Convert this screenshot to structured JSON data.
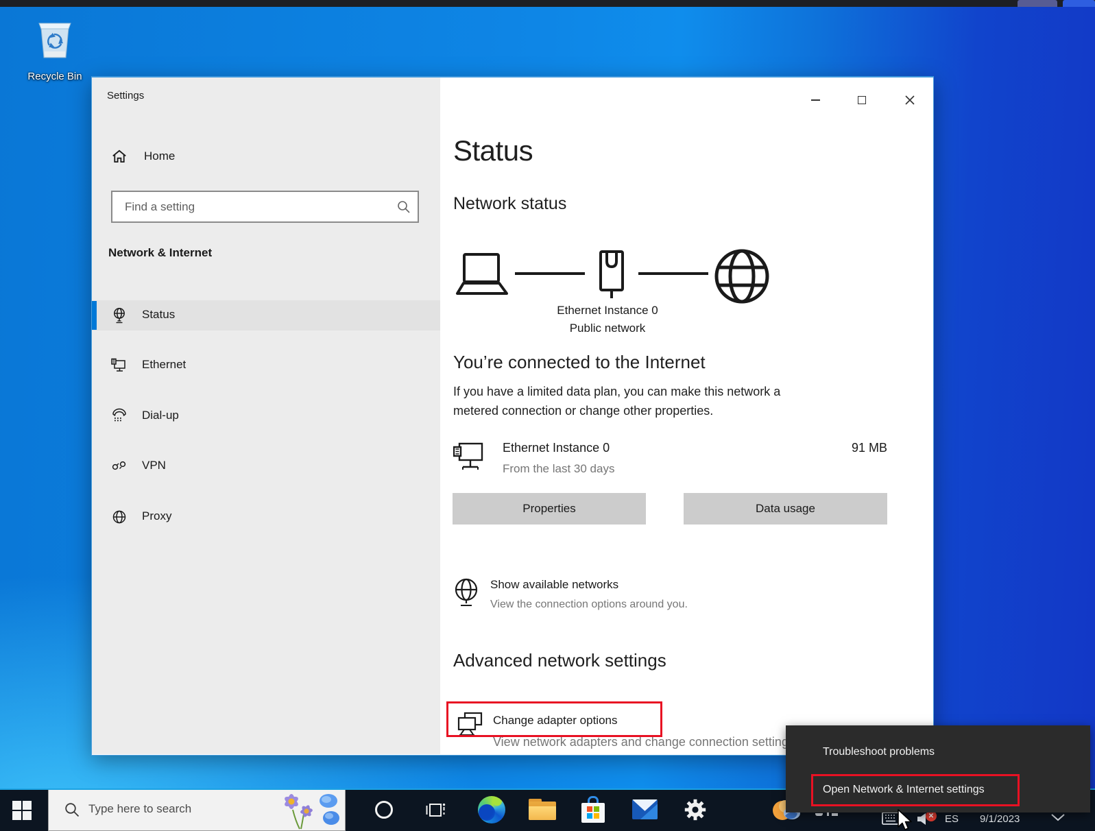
{
  "desktop": {
    "recycle_bin_label": "Recycle Bin"
  },
  "window": {
    "title": "Settings",
    "sidebar": {
      "home_label": "Home",
      "search_placeholder": "Find a setting",
      "section_label": "Network & Internet",
      "items": [
        {
          "label": "Status",
          "icon": "network-status-icon",
          "selected": true
        },
        {
          "label": "Ethernet",
          "icon": "ethernet-icon",
          "selected": false
        },
        {
          "label": "Dial-up",
          "icon": "dialup-icon",
          "selected": false
        },
        {
          "label": "VPN",
          "icon": "vpn-icon",
          "selected": false
        },
        {
          "label": "Proxy",
          "icon": "proxy-icon",
          "selected": false
        }
      ]
    },
    "main": {
      "page_title": "Status",
      "network_status_heading": "Network status",
      "diagram": {
        "connection_name": "Ethernet Instance 0",
        "network_type": "Public network"
      },
      "connected_heading": "You’re connected to the Internet",
      "connected_body": "If you have a limited data plan, you can make this network a metered connection or change other properties.",
      "adapter": {
        "name": "Ethernet Instance 0",
        "period": "From the last 30 days",
        "usage": "91 MB"
      },
      "buttons": {
        "properties": "Properties",
        "data_usage": "Data usage"
      },
      "show_networks": {
        "title": "Show available networks",
        "subtitle": "View the connection options around you."
      },
      "advanced_heading": "Advanced network settings",
      "change_adapter": {
        "title": "Change adapter options",
        "subtitle": "View network adapters and change connection settings."
      }
    }
  },
  "context_menu": {
    "items": [
      {
        "label": "Troubleshoot problems",
        "highlighted": false
      },
      {
        "label": "Open Network & Internet settings",
        "highlighted": true
      }
    ]
  },
  "taskbar": {
    "search_placeholder": "Type here to search",
    "tray": {
      "language": "ES",
      "date": "9/1/2023"
    }
  },
  "colors": {
    "accent": "#0078d7",
    "highlight_red": "#e81123",
    "selected_indicator": "#0078d7"
  }
}
